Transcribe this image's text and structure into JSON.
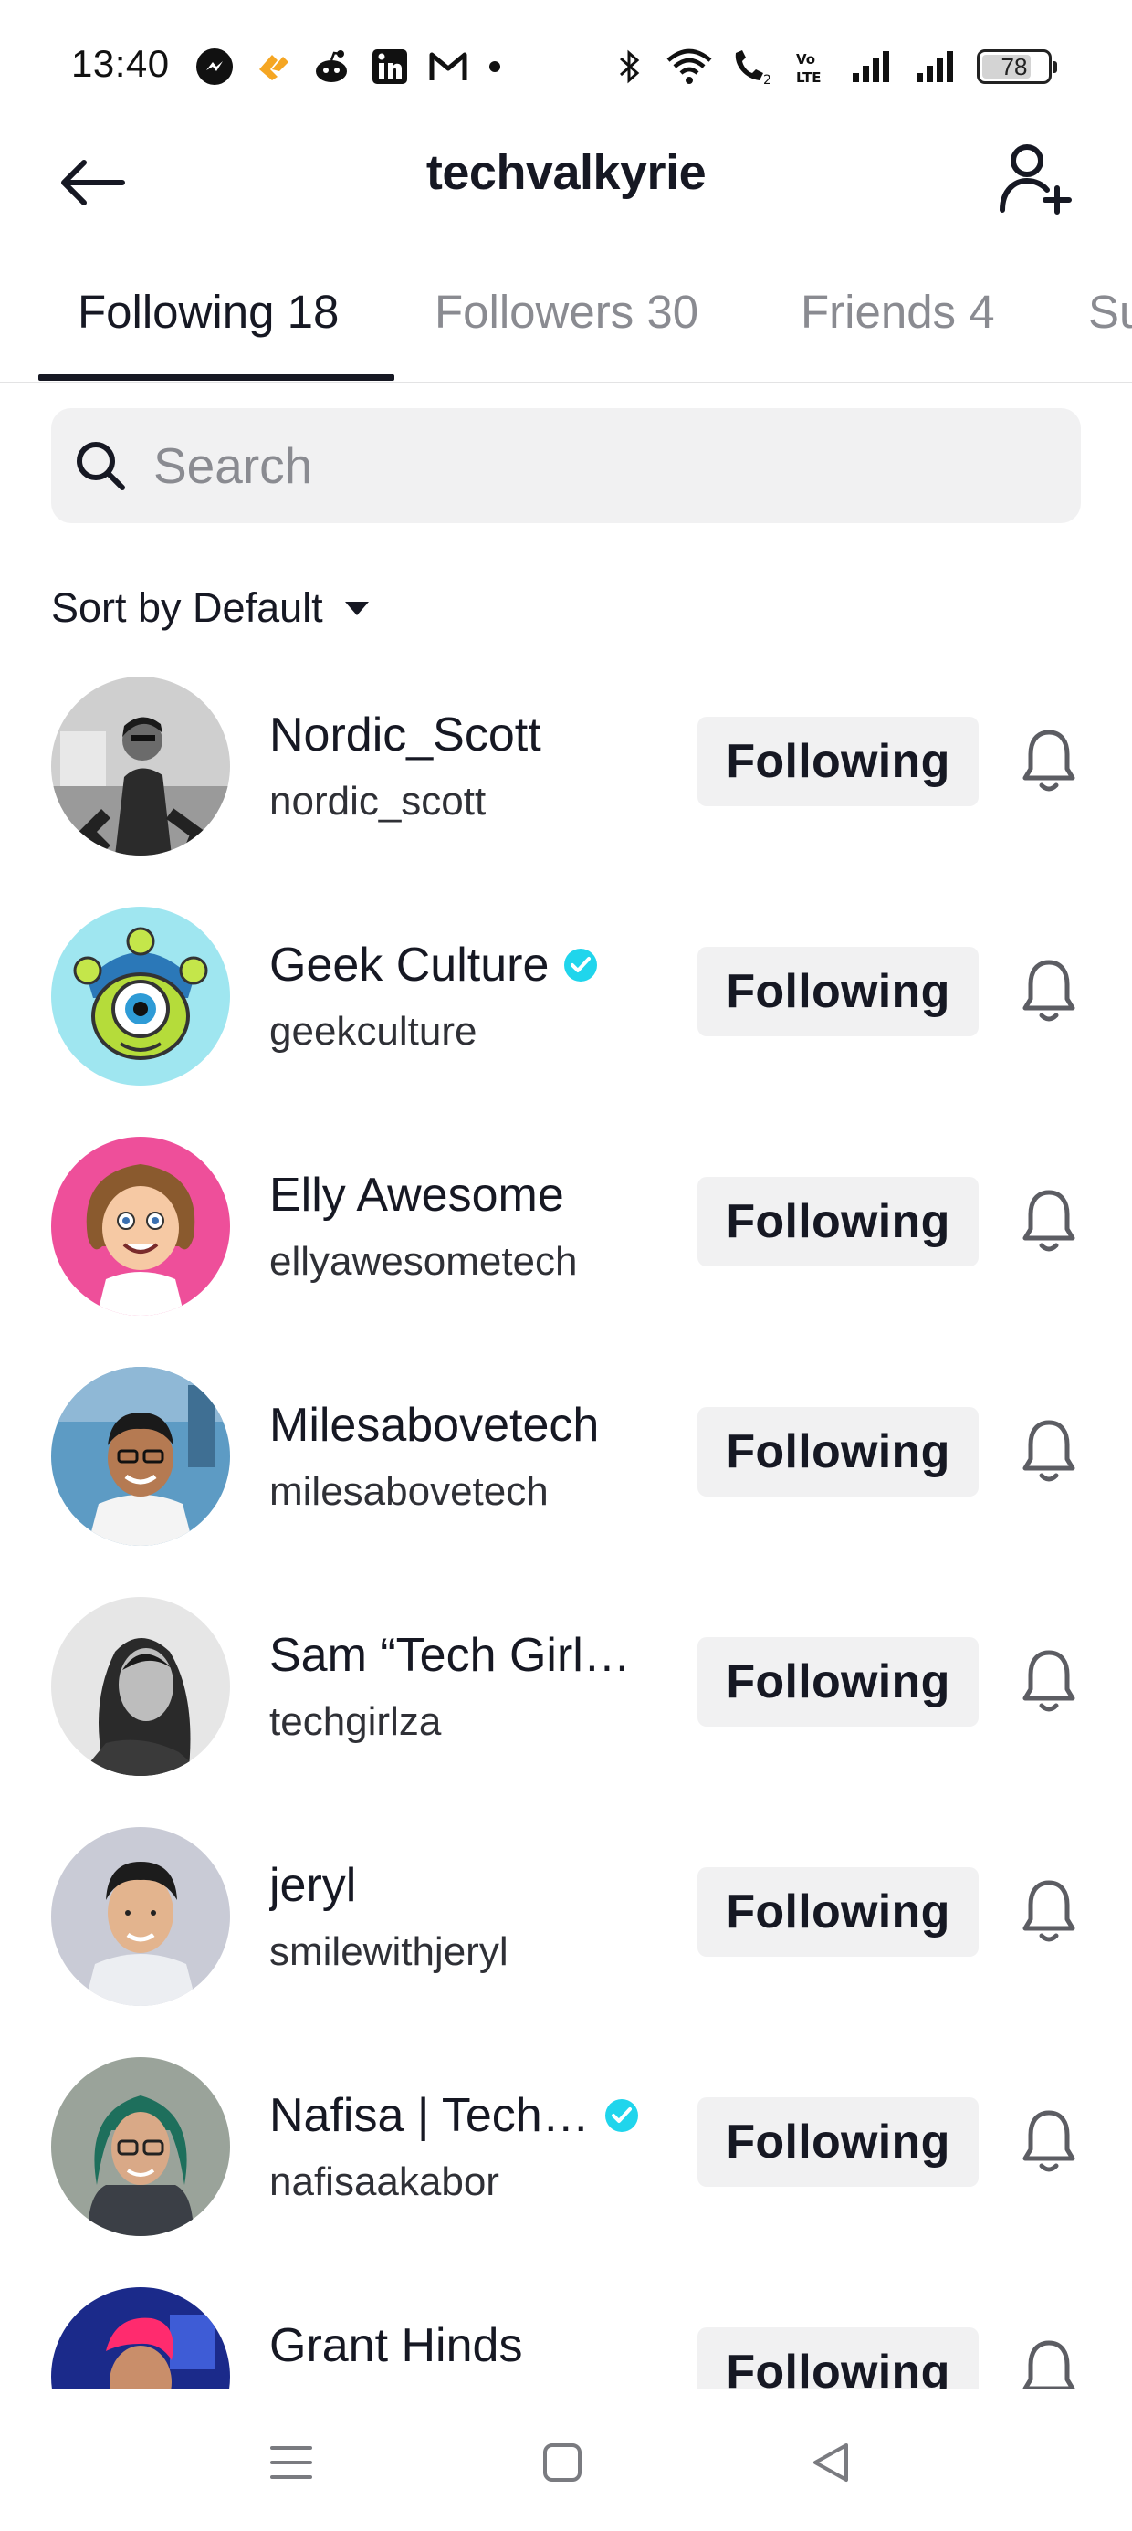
{
  "status_bar": {
    "time": "13:40",
    "left_icons": [
      "messenger-icon",
      "bolt-app-icon",
      "reddit-icon",
      "linkedin-icon",
      "gmail-icon",
      "dot-icon"
    ],
    "right_icons": [
      "bluetooth-icon",
      "wifi-icon",
      "wifi-calling-icon",
      "volte-icon",
      "signal-icon",
      "signal-icon"
    ],
    "battery": "78",
    "battery_level": 0.78
  },
  "header": {
    "title": "techvalkyrie",
    "back_icon": "arrow-left-icon",
    "add_icon": "add-person-icon"
  },
  "tabs": [
    {
      "label": "Following 18",
      "active": true
    },
    {
      "label": "Followers 30",
      "active": false
    },
    {
      "label": "Friends 4",
      "active": false
    },
    {
      "label": "Su",
      "active": false
    }
  ],
  "search": {
    "placeholder": "Search",
    "value": ""
  },
  "sort": {
    "label": "Sort by Default"
  },
  "following_button_label": "Following",
  "users": [
    {
      "name": "Nordic_Scott",
      "username": "nordic_scott",
      "verified": false
    },
    {
      "name": "Geek Culture",
      "username": "geekculture",
      "verified": true
    },
    {
      "name": "Elly Awesome",
      "username": "ellyawesometech",
      "verified": false
    },
    {
      "name": "Milesabovetech",
      "username": "milesabovetech",
      "verified": false
    },
    {
      "name": "Sam “Tech Girl…",
      "username": "techgirlza",
      "verified": false
    },
    {
      "name": "jeryl",
      "username": "smilewithjeryl",
      "verified": false
    },
    {
      "name": "Nafisa | Tech…",
      "username": "nafisaakabor",
      "verified": true
    },
    {
      "name": "Grant Hinds",
      "username": "",
      "verified": false
    }
  ],
  "colors": {
    "text_primary": "#161823",
    "text_secondary": "#8a8b91",
    "button_bg": "#f1f1f2",
    "verified": "#20d5ec"
  },
  "nav_bar": {
    "icons": [
      "menu-icon",
      "home-square-icon",
      "back-triangle-icon"
    ]
  }
}
